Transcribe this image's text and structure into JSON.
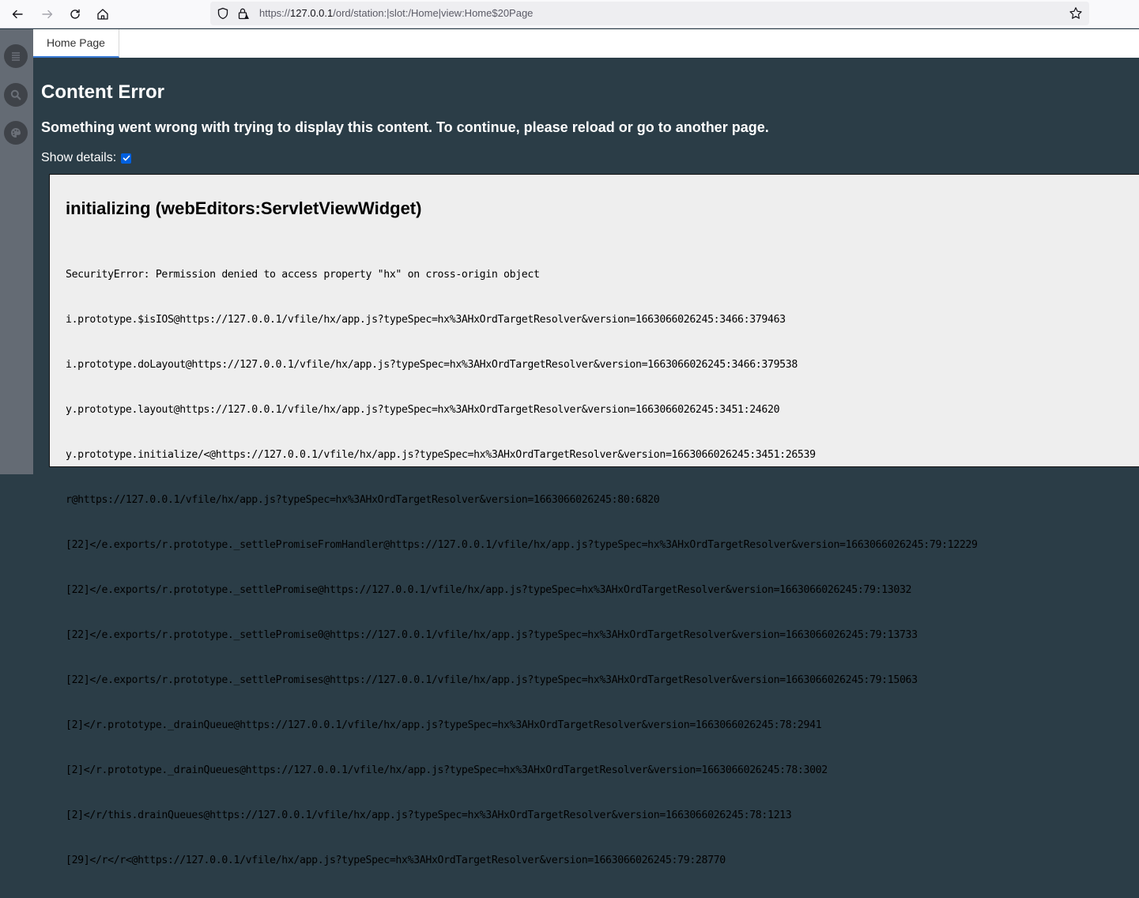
{
  "browser": {
    "url_prefix": "https://",
    "url_host": "127.0.0.1",
    "url_path": "/ord/station:|slot:/Home|view:Home$20Page",
    "icons": [
      "back-arrow-icon",
      "forward-arrow-icon",
      "reload-icon",
      "home-icon",
      "shield-icon",
      "lock-warning-icon",
      "bookmark-star-icon"
    ]
  },
  "rail": {
    "items": [
      {
        "name": "menu",
        "icon": "menu-icon"
      },
      {
        "name": "search",
        "icon": "search-icon"
      },
      {
        "name": "themes",
        "icon": "palette-icon"
      }
    ]
  },
  "tabs": [
    {
      "label": "Home Page",
      "active": true
    }
  ],
  "content": {
    "title": "Content Error",
    "subtitle": "Something went wrong with trying to display this content. To continue, please reload or go to another page.",
    "show_details_label": "Show details:",
    "show_details_checked": true
  },
  "details": {
    "heading": "initializing (webEditors:ServletViewWidget)",
    "stack": [
      "SecurityError: Permission denied to access property \"hx\" on cross-origin object",
      "i.prototype.$isIOS@https://127.0.0.1/vfile/hx/app.js?typeSpec=hx%3AHxOrdTargetResolver&version=1663066026245:3466:379463",
      "i.prototype.doLayout@https://127.0.0.1/vfile/hx/app.js?typeSpec=hx%3AHxOrdTargetResolver&version=1663066026245:3466:379538",
      "y.prototype.layout@https://127.0.0.1/vfile/hx/app.js?typeSpec=hx%3AHxOrdTargetResolver&version=1663066026245:3451:24620",
      "y.prototype.initialize/<@https://127.0.0.1/vfile/hx/app.js?typeSpec=hx%3AHxOrdTargetResolver&version=1663066026245:3451:26539",
      "r@https://127.0.0.1/vfile/hx/app.js?typeSpec=hx%3AHxOrdTargetResolver&version=1663066026245:80:6820",
      "[22]</e.exports/r.prototype._settlePromiseFromHandler@https://127.0.0.1/vfile/hx/app.js?typeSpec=hx%3AHxOrdTargetResolver&version=1663066026245:79:12229",
      "[22]</e.exports/r.prototype._settlePromise@https://127.0.0.1/vfile/hx/app.js?typeSpec=hx%3AHxOrdTargetResolver&version=1663066026245:79:13032",
      "[22]</e.exports/r.prototype._settlePromise0@https://127.0.0.1/vfile/hx/app.js?typeSpec=hx%3AHxOrdTargetResolver&version=1663066026245:79:13733",
      "[22]</e.exports/r.prototype._settlePromises@https://127.0.0.1/vfile/hx/app.js?typeSpec=hx%3AHxOrdTargetResolver&version=1663066026245:79:15063",
      "[2]</r.prototype._drainQueue@https://127.0.0.1/vfile/hx/app.js?typeSpec=hx%3AHxOrdTargetResolver&version=1663066026245:78:2941",
      "[2]</r.prototype._drainQueues@https://127.0.0.1/vfile/hx/app.js?typeSpec=hx%3AHxOrdTargetResolver&version=1663066026245:78:3002",
      "[2]</r/this.drainQueues@https://127.0.0.1/vfile/hx/app.js?typeSpec=hx%3AHxOrdTargetResolver&version=1663066026245:78:1213",
      "[29]</r</r<@https://127.0.0.1/vfile/hx/app.js?typeSpec=hx%3AHxOrdTargetResolver&version=1663066026245:79:28770"
    ]
  },
  "colors": {
    "content_bg": "#2b3d47",
    "rail_bg": "#646b74",
    "details_bg": "#eeeeee",
    "checkbox": "#0060df",
    "tab_underline": "#3a7bd5"
  }
}
